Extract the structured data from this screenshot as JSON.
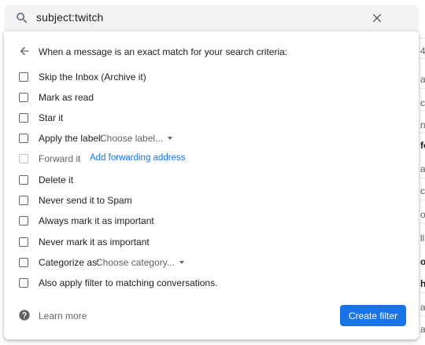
{
  "search": {
    "query": "subject:twitch"
  },
  "panel": {
    "header": "When a message is an exact match for your search criteria:",
    "options": [
      {
        "label": "Skip the Inbox (Archive it)"
      },
      {
        "label": "Mark as read"
      },
      {
        "label": "Star it"
      },
      {
        "label": "Apply the label:",
        "dropdown": "Choose label..."
      },
      {
        "label": "Forward it",
        "link": "Add forwarding address",
        "disabled": true
      },
      {
        "label": "Delete it"
      },
      {
        "label": "Never send it to Spam"
      },
      {
        "label": "Always mark it as important"
      },
      {
        "label": "Never mark it as important"
      },
      {
        "label": "Categorize as:",
        "dropdown": "Choose category..."
      },
      {
        "label": "Also apply filter to matching conversations."
      }
    ],
    "footer": {
      "learn_more": "Learn more",
      "create_label": "Create filter"
    }
  },
  "background": {
    "fragments": [
      {
        "text": "4-",
        "bold": false
      },
      {
        "text": "a",
        "bold": false
      },
      {
        "text": "c",
        "bold": false
      },
      {
        "text": "n",
        "bold": false
      },
      {
        "text": "fo",
        "bold": true
      },
      {
        "text": "av",
        "bold": false
      },
      {
        "text": "cc",
        "bold": false
      },
      {
        "text": "or",
        "bold": false
      },
      {
        "text": "ll",
        "bold": false
      },
      {
        "text": "o",
        "bold": true
      },
      {
        "text": "h",
        "bold": true
      },
      {
        "text": "a",
        "bold": false
      },
      {
        "text": "a",
        "bold": false
      }
    ]
  },
  "colors": {
    "accent": "#1a73e8",
    "search_bg": "#f1f3f4",
    "text": "#202124",
    "muted": "#5f6368"
  },
  "icons": [
    "search-icon",
    "close-icon",
    "arrow-back-icon",
    "help-icon",
    "chevron-down-icon"
  ]
}
